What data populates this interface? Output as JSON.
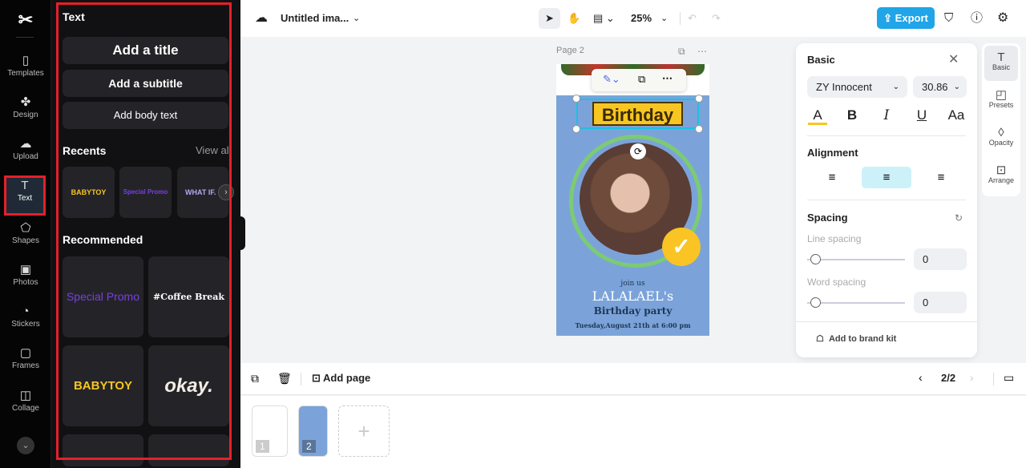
{
  "rail": {
    "items": [
      {
        "label": "Templates",
        "icon": "▯"
      },
      {
        "label": "Design",
        "icon": "✤"
      },
      {
        "label": "Upload",
        "icon": "☁"
      },
      {
        "label": "Text",
        "icon": "T"
      },
      {
        "label": "Shapes",
        "icon": "⬠"
      },
      {
        "label": "Photos",
        "icon": "▣"
      },
      {
        "label": "Stickers",
        "icon": "◔"
      },
      {
        "label": "Frames",
        "icon": "▢"
      },
      {
        "label": "Collage",
        "icon": "◫"
      }
    ]
  },
  "panel": {
    "title": "Text",
    "add_title": "Add a title",
    "add_subtitle": "Add a subtitle",
    "add_body": "Add body text",
    "recents_label": "Recents",
    "view_all": "View all",
    "recents": [
      "BABYTOY",
      "Special Promo",
      "WHAT IF."
    ],
    "recommended_label": "Recommended",
    "recommended": [
      "Special Promo",
      "#Coffee Break",
      "BABYTOY",
      "okay."
    ]
  },
  "topbar": {
    "doc_title": "Untitled ima...",
    "zoom": "25%",
    "export": "Export"
  },
  "canvas": {
    "page_label": "Page 2",
    "poster": {
      "headline": "Birthday",
      "join": "join us",
      "name": "LALALAEL's",
      "party": "Birthday party",
      "date": "Tuesday,August 21th at 6:00 pm"
    }
  },
  "props": {
    "title": "Basic",
    "font": "ZY Innocent",
    "size": "30.86",
    "alignment": "Alignment",
    "spacing": "Spacing",
    "line_spacing": "Line spacing",
    "line_value": "0",
    "word_spacing": "Word spacing",
    "word_value": "0",
    "brand_kit": "Add to brand kit",
    "accent": "#f7c623"
  },
  "sidetabs": [
    {
      "label": "Basic",
      "icon": "T"
    },
    {
      "label": "Presets",
      "icon": "◰"
    },
    {
      "label": "Opacity",
      "icon": "◊"
    },
    {
      "label": "Arrange",
      "icon": "⊡"
    }
  ],
  "bottom": {
    "add_page": "Add page",
    "page_count": "2/2",
    "thumbs": [
      "1",
      "2"
    ]
  }
}
